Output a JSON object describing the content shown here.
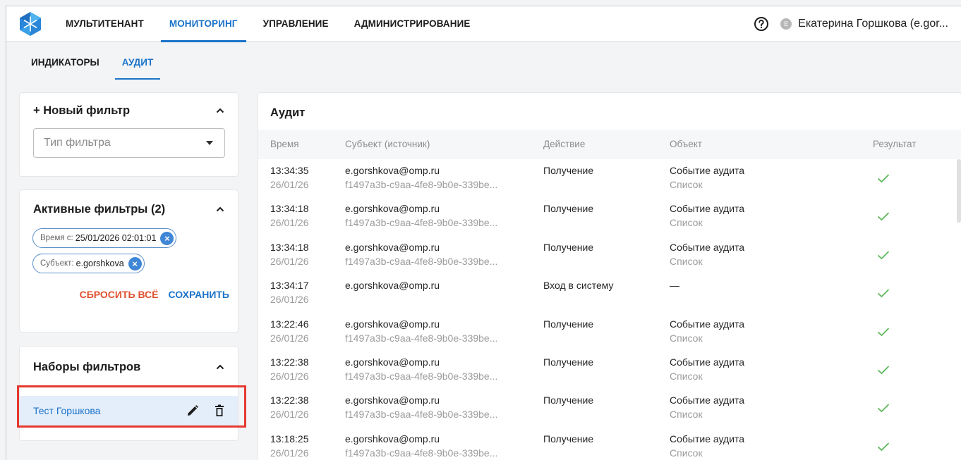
{
  "topnav": {
    "items": [
      "МУЛЬТИТЕНАНТ",
      "МОНИТОРИНГ",
      "УПРАВЛЕНИЕ",
      "АДМИНИСТРИРОВАНИЕ"
    ],
    "active_index": 1,
    "avatar_letter": "E",
    "username": "Екатерина Горшкова (e.gor..."
  },
  "subtabs": {
    "items": [
      "ИНДИКАТОРЫ",
      "АУДИТ"
    ],
    "active_index": 1
  },
  "new_filter": {
    "title": "+ Новый фильтр",
    "select_placeholder": "Тип фильтра"
  },
  "active_filters": {
    "title": "Активные фильтры (2)",
    "chips": [
      {
        "key": "Время с:",
        "value": "25/01/2026 02:01:01"
      },
      {
        "key": "Субъект:",
        "value": "e.gorshkova"
      }
    ],
    "reset_label": "СБРОСИТЬ ВСЁ",
    "save_label": "СОХРАНИТЬ"
  },
  "filter_sets": {
    "title": "Наборы фильтров",
    "items": [
      {
        "name": "Тест Горшкова"
      }
    ]
  },
  "audit": {
    "title": "Аудит",
    "columns": [
      "Время",
      "Субъект (источник)",
      "Действие",
      "Объект",
      "Результат"
    ],
    "rows": [
      {
        "time": "13:34:35",
        "date": "26/01/26",
        "subject": "e.gorshkova@omp.ru",
        "source": "f1497a3b-c9aa-4fe8-9b0e-339be...",
        "action": "Получение",
        "object": "Событие аудита",
        "object_sub": "Список",
        "result": "success"
      },
      {
        "time": "13:34:18",
        "date": "26/01/26",
        "subject": "e.gorshkova@omp.ru",
        "source": "f1497a3b-c9aa-4fe8-9b0e-339be...",
        "action": "Получение",
        "object": "Событие аудита",
        "object_sub": "Список",
        "result": "success"
      },
      {
        "time": "13:34:18",
        "date": "26/01/26",
        "subject": "e.gorshkova@omp.ru",
        "source": "f1497a3b-c9aa-4fe8-9b0e-339be...",
        "action": "Получение",
        "object": "Событие аудита",
        "object_sub": "Список",
        "result": "success"
      },
      {
        "time": "13:34:17",
        "date": "26/01/26",
        "subject": "e.gorshkova@omp.ru",
        "source": "",
        "action": "Вход в систему",
        "object": "—",
        "object_sub": "",
        "result": "success"
      },
      {
        "time": "13:22:46",
        "date": "26/01/26",
        "subject": "e.gorshkova@omp.ru",
        "source": "f1497a3b-c9aa-4fe8-9b0e-339be...",
        "action": "Получение",
        "object": "Событие аудита",
        "object_sub": "Список",
        "result": "success"
      },
      {
        "time": "13:22:38",
        "date": "26/01/26",
        "subject": "e.gorshkova@omp.ru",
        "source": "f1497a3b-c9aa-4fe8-9b0e-339be...",
        "action": "Получение",
        "object": "Событие аудита",
        "object_sub": "Список",
        "result": "success"
      },
      {
        "time": "13:22:38",
        "date": "26/01/26",
        "subject": "e.gorshkova@omp.ru",
        "source": "f1497a3b-c9aa-4fe8-9b0e-339be...",
        "action": "Получение",
        "object": "Событие аудита",
        "object_sub": "Список",
        "result": "success"
      },
      {
        "time": "13:18:25",
        "date": "26/01/26",
        "subject": "e.gorshkova@omp.ru",
        "source": "f1497a3b-c9aa-4fe8-9b0e-339be...",
        "action": "Получение",
        "object": "Событие аудита",
        "object_sub": "Список",
        "result": "success"
      }
    ]
  },
  "colors": {
    "accent": "#1b73c8",
    "danger": "#e0502f",
    "success": "#5cb85c",
    "highlight": "#e5392f"
  },
  "icons": [
    "app-logo-icon",
    "help-icon",
    "chevron-up-icon",
    "dropdown-caret-icon",
    "remove-chip-icon",
    "edit-pencil-icon",
    "delete-trash-icon",
    "success-check-icon"
  ]
}
